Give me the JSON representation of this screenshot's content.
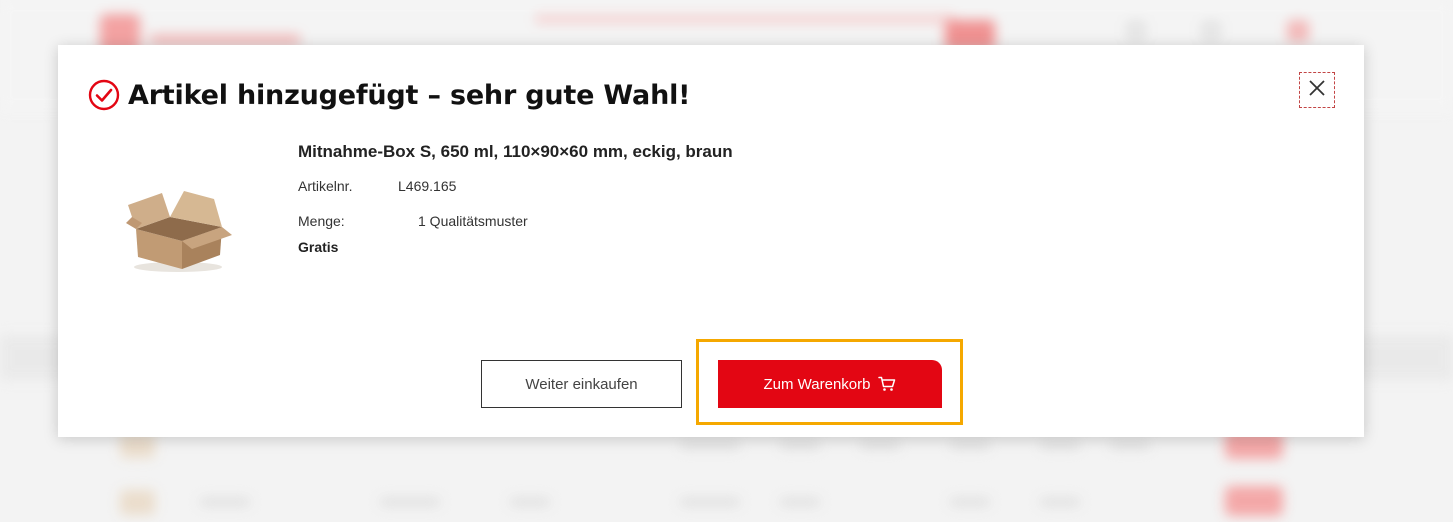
{
  "modal": {
    "title": "Artikel hinzugefügt – sehr gute Wahl!",
    "product": {
      "name": "Mitnahme-Box S, 650 ml, 110×90×60 mm, eckig, braun",
      "article_label": "Artikelnr.",
      "article_value": "L469.165",
      "quantity_label": "Menge:",
      "quantity_value": "1 Qualitätsmuster",
      "price": "Gratis"
    },
    "buttons": {
      "continue_label": "Weiter einkaufen",
      "cart_label": "Zum Warenkorb"
    },
    "icons": {
      "success": "check-circle-icon",
      "close": "close-icon",
      "cart": "cart-icon"
    }
  },
  "colors": {
    "accent_red": "#e30613",
    "focus_outline": "#f5a800"
  }
}
